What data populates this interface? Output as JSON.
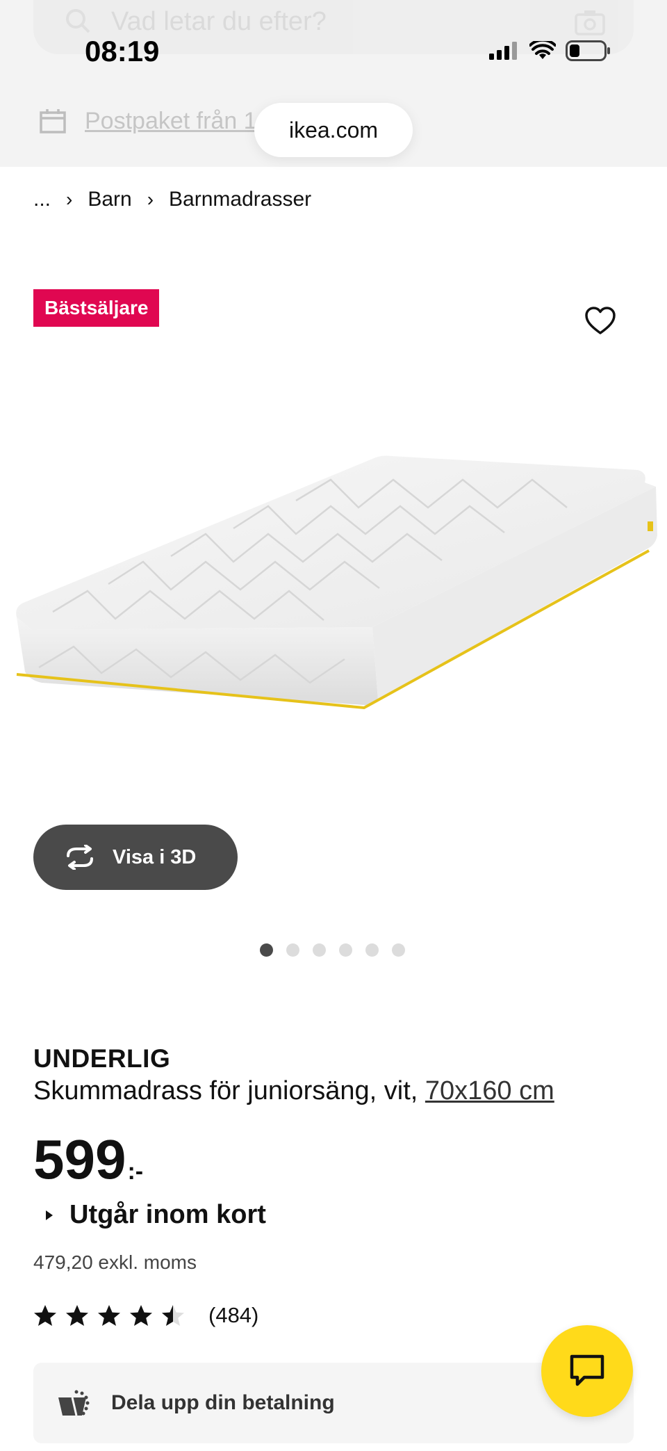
{
  "header": {
    "search_placeholder": "Vad letar du efter?",
    "postpaket_text": "Postpaket från 1",
    "url": "ikea.com"
  },
  "status_bar": {
    "time": "08:19"
  },
  "breadcrumb": {
    "ellipsis": "...",
    "items": [
      "Barn",
      "Barnmadrasser"
    ]
  },
  "badge": {
    "label": "Bästsäljare"
  },
  "product": {
    "name": "UNDERLIG",
    "description": "Skummadrass för juniorsäng, vit, ",
    "size_link": "70x160 cm",
    "price": "599",
    "price_suffix": ":-",
    "availability": "Utgår inom kort",
    "price_excl_vat": "479,20 exkl. moms",
    "rating": 4.5,
    "rating_count": "(484)"
  },
  "view_3d": {
    "label": "Visa i 3D"
  },
  "carousel": {
    "total": 6,
    "active": 1
  },
  "payment": {
    "label": "Dela upp din betalning"
  },
  "colors": {
    "badge": "#e00751",
    "chat_fab": "#ffda1a",
    "button_dark": "#4a4a4a"
  },
  "icons": [
    "search-icon",
    "camera-icon",
    "wifi-icon",
    "battery-icon",
    "box-icon",
    "heart-icon",
    "rotate-3d-icon",
    "star-icon",
    "basket-icon",
    "chat-icon"
  ]
}
